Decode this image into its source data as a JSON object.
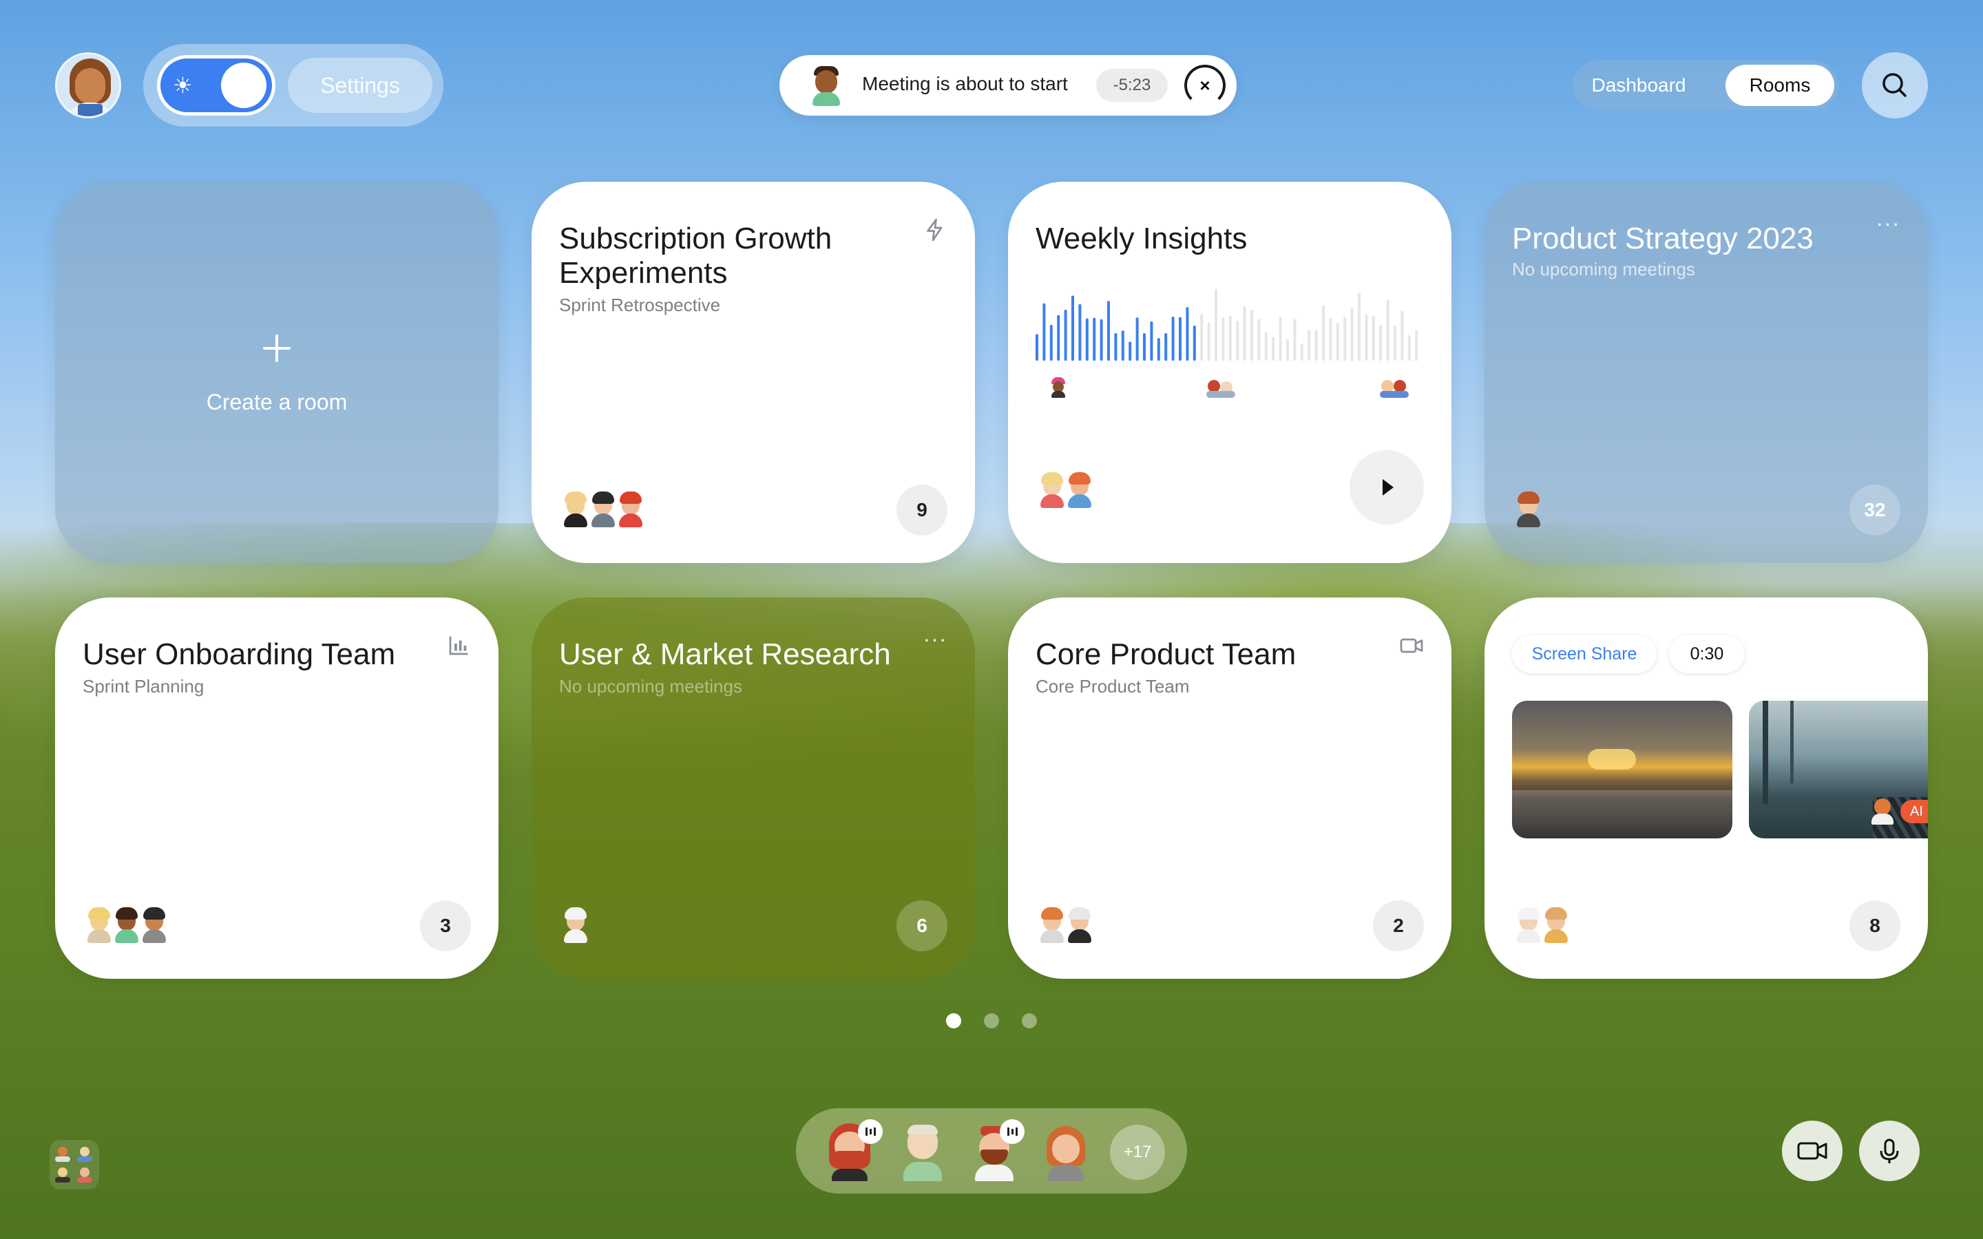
{
  "header": {
    "settings_label": "Settings",
    "toggle_icon": "sun-icon",
    "toggle_on": true,
    "meeting_banner": {
      "text": "Meeting is about to start",
      "countdown": "-5:23"
    },
    "nav_tabs": [
      {
        "label": "Dashboard",
        "active": false
      },
      {
        "label": "Rooms",
        "active": true
      }
    ]
  },
  "create_room": {
    "label": "Create a room"
  },
  "rooms": [
    {
      "title": "Subscription Growth Experiments",
      "subtitle": "Sprint Retrospective",
      "icon": "lightning-icon",
      "count": "9"
    },
    {
      "title": "Weekly Insights",
      "icon": "play-icon"
    },
    {
      "title": "Product Strategy 2023",
      "subtitle": "No upcoming meetings",
      "icon": "more-icon",
      "count": "32"
    },
    {
      "title": "User Onboarding Team",
      "subtitle": "Sprint Planning",
      "icon": "chart-icon",
      "count": "3"
    },
    {
      "title": "User & Market Research",
      "subtitle": "No upcoming meetings",
      "icon": "more-icon",
      "count": "6"
    },
    {
      "title": "Core Product Team",
      "subtitle": "Core Product Team",
      "icon": "video-icon",
      "count": "2"
    },
    {
      "screen_share_label": "Screen Share",
      "timer": "0:30",
      "thumb_badge": "AI",
      "count": "8"
    }
  ],
  "pagination": {
    "pages": 3,
    "active": 1
  },
  "dock": {
    "more_label": "+17"
  },
  "colors": {
    "accent": "#3b7ff0",
    "waveform_active": "#3b7ff0",
    "waveform_inactive": "#e4e6ea"
  }
}
